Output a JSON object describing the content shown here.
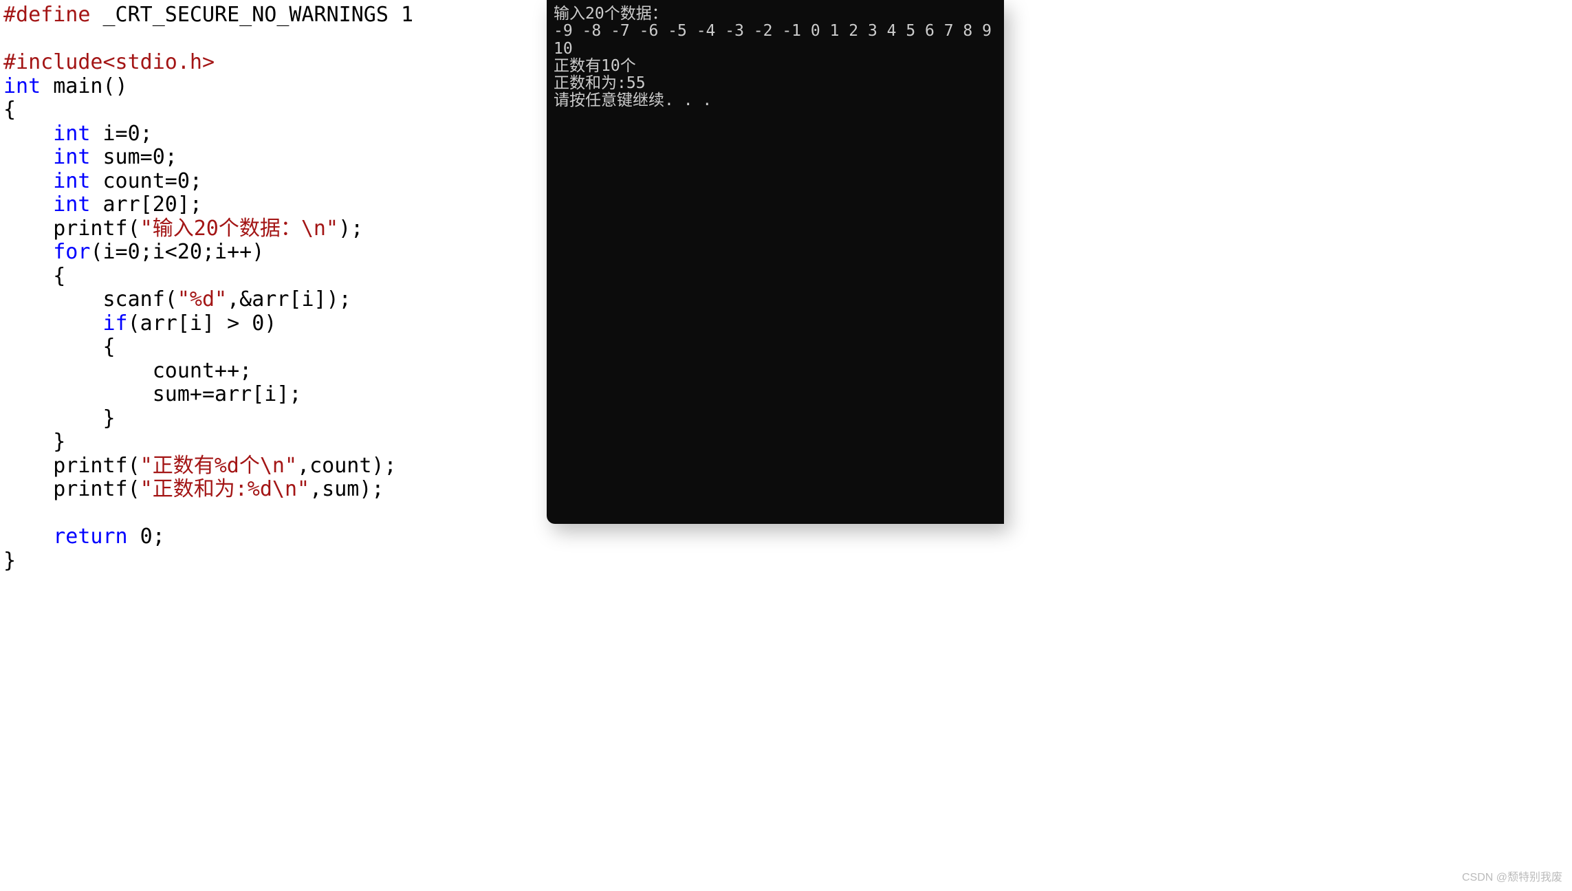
{
  "code": {
    "line1_define": "#define",
    "line1_rest": " _CRT_SECURE_NO_WARNINGS 1",
    "blank": "",
    "line3_include": "#include",
    "line3_header": "<stdio.h>",
    "line4_int": "int",
    "line4_main": " main()",
    "line5_brace": "{",
    "line6_int": "    int",
    "line6_rest": " i=0;",
    "line7_int": "    int",
    "line7_rest": " sum=0;",
    "line8_int": "    int",
    "line8_rest": " count=0;",
    "line9_int": "    int",
    "line9_rest": " arr[20];",
    "line10_pre": "    printf(",
    "line10_str": "\"输入20个数据：\\n\"",
    "line10_post": ");",
    "line11_for": "    for",
    "line11_rest": "(i=0;i<20;i++)",
    "line12": "    {",
    "line13_pre": "        scanf(",
    "line13_str": "\"%d\"",
    "line13_post": ",&arr[i]);",
    "line14_if": "        if",
    "line14_rest": "(arr[i] > 0)",
    "line15": "        {",
    "line16": "            count++;",
    "line17": "            sum+=arr[i];",
    "line18": "        }",
    "line19": "    }",
    "line20_pre": "    printf(",
    "line20_str": "\"正数有%d个\\n\"",
    "line20_post": ",count);",
    "line21_pre": "    printf(",
    "line21_str": "\"正数和为:%d\\n\"",
    "line21_post": ",sum);",
    "line22_return": "    return",
    "line22_rest": " 0;",
    "line23": "}"
  },
  "terminal": {
    "line1": "输入20个数据：",
    "line2": "-9 -8 -7 -6 -5 -4 -3 -2 -1 0 1 2 3 4 5 6 7 8 9 10",
    "line3": "正数有10个",
    "line4": "正数和为:55",
    "line5": "请按任意键继续. . ."
  },
  "watermark": "CSDN @颓特别我废"
}
